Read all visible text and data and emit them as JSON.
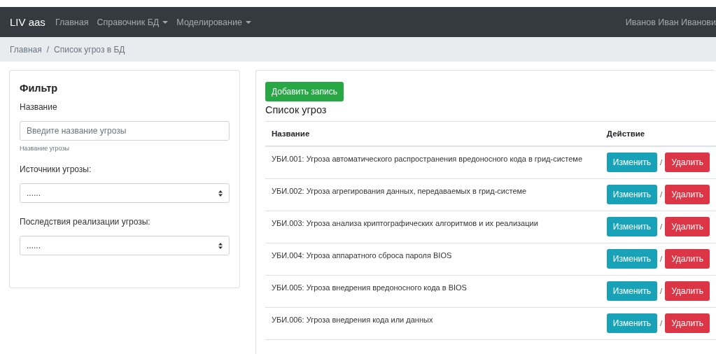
{
  "navbar": {
    "brand": "LIV aas",
    "links": [
      {
        "label": "Главная",
        "dropdown": false
      },
      {
        "label": "Справочник БД",
        "dropdown": true
      },
      {
        "label": "Моделирование",
        "dropdown": true
      }
    ],
    "user": "Иванов Иван Иванови"
  },
  "breadcrumb": {
    "separator": "/",
    "items": [
      "Главная",
      "Список угроз в БД"
    ]
  },
  "filter": {
    "title": "Фильтр",
    "fields": [
      {
        "kind": "text",
        "label": "Название",
        "placeholder": "Введите название угрозы",
        "help": "Название угрозы"
      },
      {
        "kind": "select",
        "label": "Источники угрозы:",
        "value": "......"
      },
      {
        "kind": "select",
        "label": "Последствия реализации угрозы:",
        "value": "......"
      }
    ]
  },
  "threats": {
    "add_button": "Добавить запись",
    "title": "Список угроз",
    "columns": [
      "Название",
      "Действие"
    ],
    "rows": [
      {
        "name": "УБИ.001: Угроза автоматического распространения вредоносного кода в грид-системе",
        "edit": "Изменить",
        "separator": "/",
        "delete": "Удалить"
      },
      {
        "name": "УБИ.002: Угроза агрегирования данных, передаваемых в грид-системе",
        "edit": "Изменить",
        "separator": "/",
        "delete": "Удалить"
      },
      {
        "name": "УБИ.003: Угроза анализа криптографических алгоритмов и их реализации",
        "edit": "Изменить",
        "separator": "/",
        "delete": "Удалить"
      },
      {
        "name": "УБИ.004: Угроза аппаратного сброса пароля BIOS",
        "edit": "Изменить",
        "separator": "/",
        "delete": "Удалить"
      },
      {
        "name": "УБИ.005: Угроза внедрения вредоносного кода в BIOS",
        "edit": "Изменить",
        "separator": "/",
        "delete": "Удалить"
      },
      {
        "name": "УБИ.006: Угроза внедрения кода или данных",
        "edit": "Изменить",
        "separator": "/",
        "delete": "Удалить"
      }
    ]
  }
}
